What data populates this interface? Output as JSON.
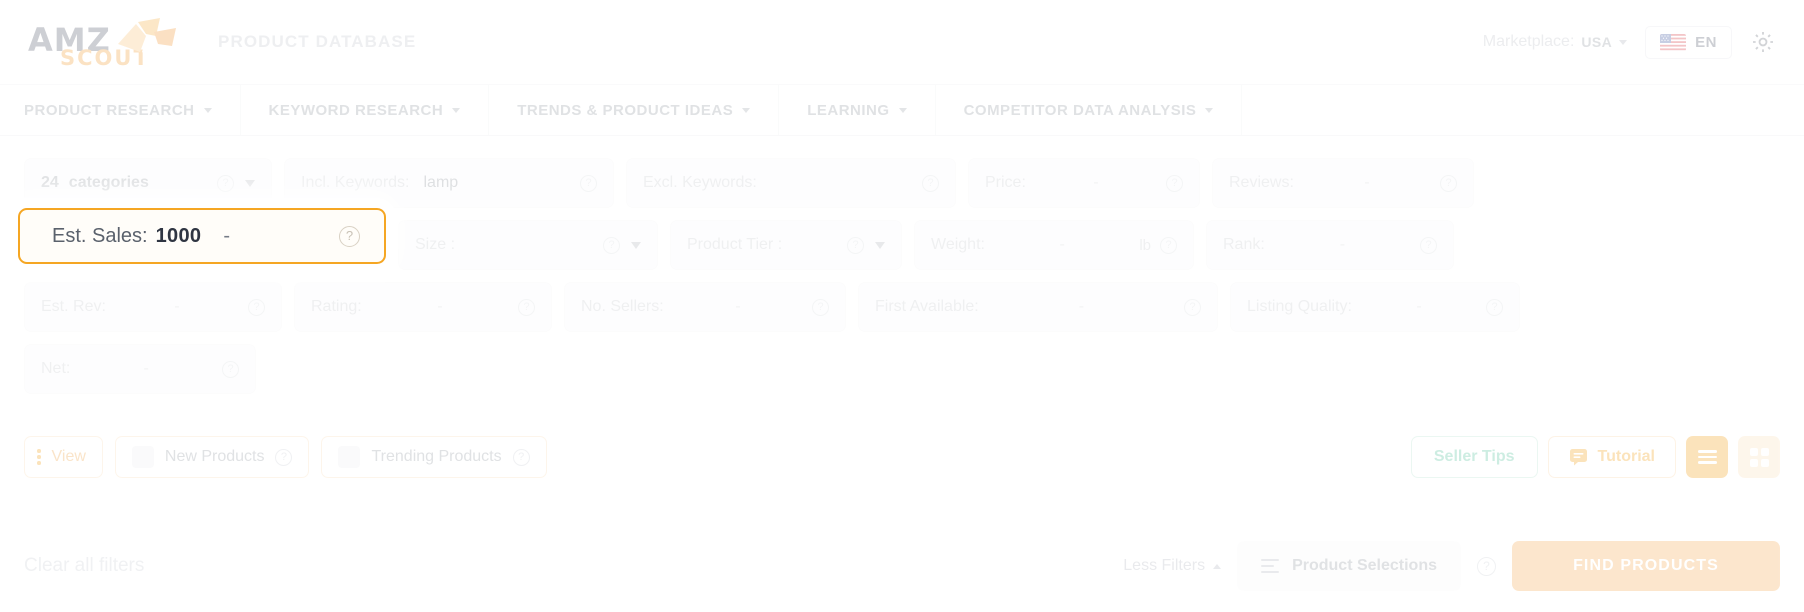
{
  "header": {
    "logo_primary": "AMZ",
    "logo_secondary": "SCOUT",
    "app_title": "PRODUCT DATABASE",
    "marketplace_label": "Marketplace:",
    "marketplace_value": "USA",
    "language": "EN",
    "settings_icon": "gear-icon"
  },
  "nav": {
    "items": [
      {
        "label": "PRODUCT RESEARCH",
        "has_caret": true
      },
      {
        "label": "KEYWORD RESEARCH",
        "has_caret": true
      },
      {
        "label": "TRENDS & PRODUCT IDEAS",
        "has_caret": true
      },
      {
        "label": "LEARNING",
        "has_caret": true
      },
      {
        "label": "COMPETITOR DATA ANALYSIS",
        "has_caret": true
      }
    ]
  },
  "filters": {
    "row1": {
      "categories_count": "24",
      "categories_label": "categories",
      "incl_keywords_label": "Incl. Keywords:",
      "incl_keywords_value": "lamp",
      "excl_keywords_label": "Excl. Keywords:",
      "excl_keywords_value": "",
      "price_label": "Price:",
      "price_value": "-",
      "reviews_label": "Reviews:",
      "reviews_value": "-"
    },
    "row2": {
      "est_sales_label": "Est. Sales:",
      "est_sales_value": "1000",
      "est_sales_dash": "-",
      "size_label": "Size :",
      "product_tier_label": "Product Tier :",
      "weight_label": "Weight:",
      "weight_value": "-",
      "weight_unit": "lb",
      "rank_label": "Rank:",
      "rank_value": "-"
    },
    "row3": {
      "est_rev_label": "Est. Rev:",
      "est_rev_value": "-",
      "rating_label": "Rating:",
      "rating_value": "-",
      "no_sellers_label": "No. Sellers:",
      "no_sellers_value": "-",
      "first_available_label": "First Available:",
      "first_available_value": "-",
      "listing_quality_label": "Listing Quality:",
      "listing_quality_value": "-"
    },
    "row4": {
      "net_label": "Net:",
      "net_value": "-"
    }
  },
  "toolbar": {
    "view_label": "View",
    "new_products_label": "New Products",
    "trending_products_label": "Trending Products",
    "seller_tips_label": "Seller Tips",
    "tutorial_label": "Tutorial",
    "list_view_icon": "list-view-icon",
    "grid_view_icon": "grid-view-icon"
  },
  "footer": {
    "clear_all_label": "Clear all filters",
    "less_filters_label": "Less Filters",
    "product_selections_label": "Product Selections",
    "find_products_label": "FIND PRODUCTS"
  },
  "colors": {
    "accent_orange": "#f5a623",
    "brand_gray": "#5d6472",
    "green": "#5cc4a0",
    "muted": "#b9bdc4"
  }
}
